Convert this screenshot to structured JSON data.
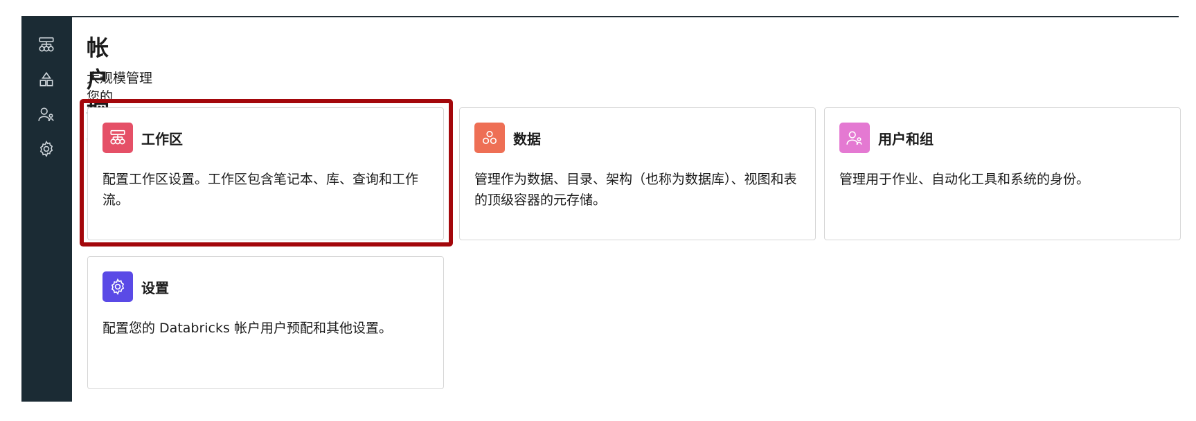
{
  "page": {
    "title": "帐户控制台",
    "subtitle": "大规模管理您的 Databricks 帐户"
  },
  "sidebar": {
    "items": [
      {
        "icon": "workspaces-icon"
      },
      {
        "icon": "catalog-icon"
      },
      {
        "icon": "users-icon"
      },
      {
        "icon": "gear-icon"
      }
    ]
  },
  "cards": [
    {
      "title": "工作区",
      "description": "配置工作区设置。工作区包含笔记本、库、查询和工作流。",
      "icon": "workspaces-icon",
      "color": "#e55067"
    },
    {
      "title": "数据",
      "description": "管理作为数据、目录、架构（也称为数据库）、视图和表的顶级容器的元存储。",
      "icon": "data-icon",
      "color": "#ee6f55"
    },
    {
      "title": "用户和组",
      "description": "管理用于作业、自动化工具和系统的身份。",
      "icon": "users-icon",
      "color": "#e479d2"
    },
    {
      "title": "设置",
      "description": "配置您的 Databricks 帐户用户预配和其他设置。",
      "icon": "gear-icon",
      "color": "#5a4ae6"
    }
  ],
  "colors": {
    "sidebar_bg": "#1b2b34",
    "highlight": "#a3070b"
  }
}
